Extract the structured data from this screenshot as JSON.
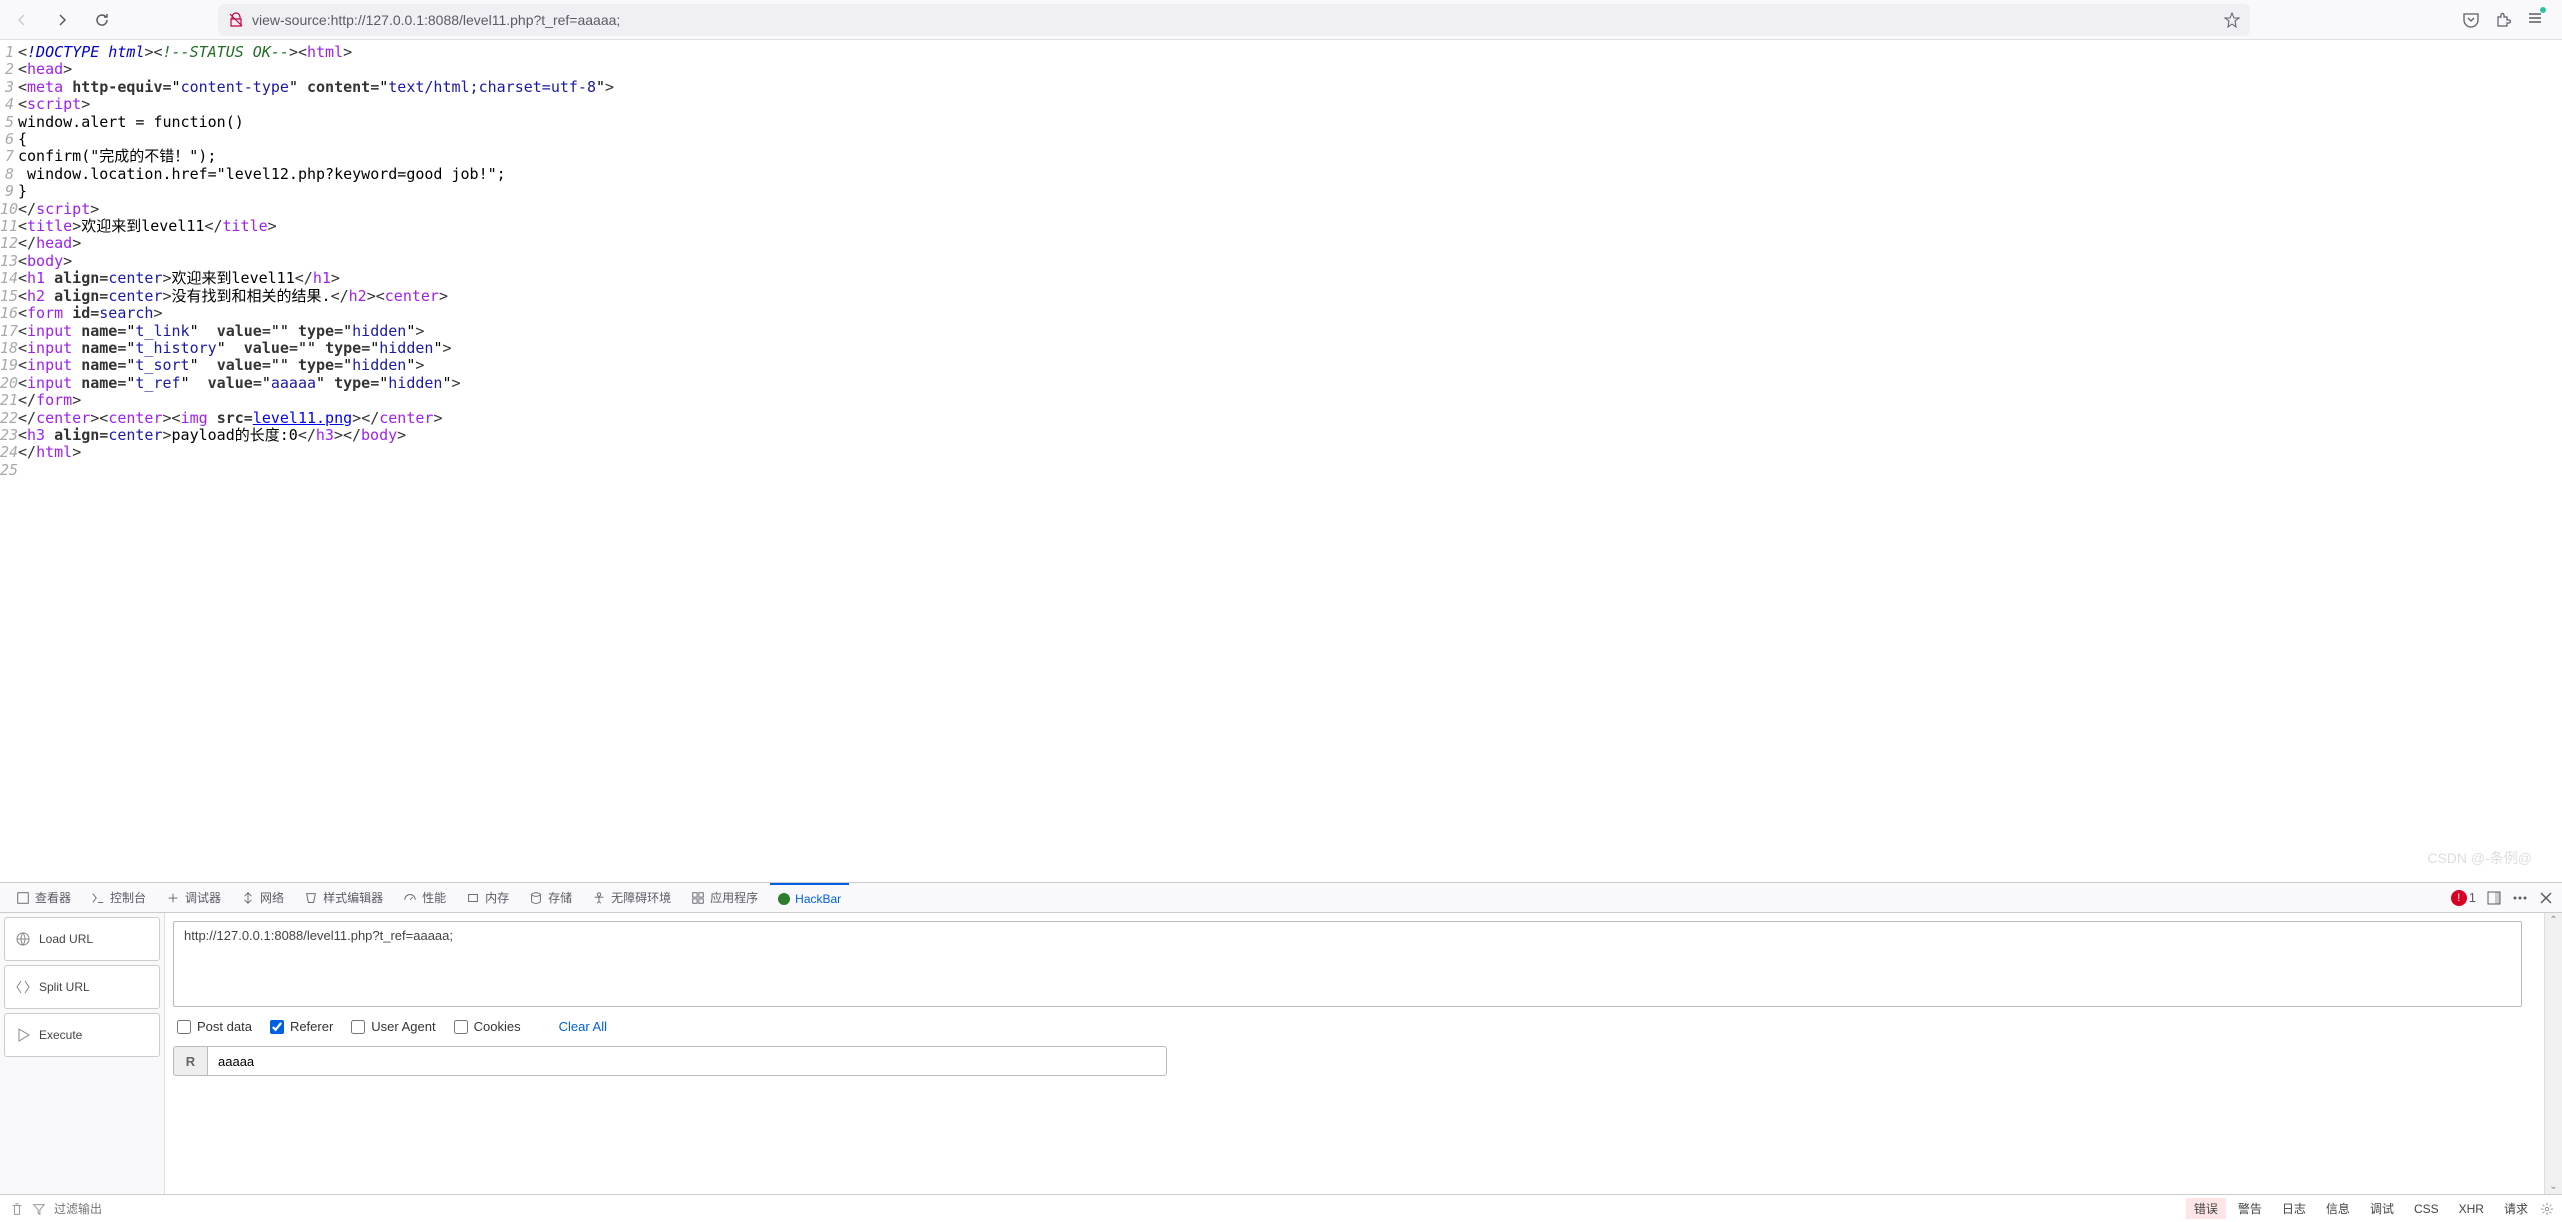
{
  "browser": {
    "url": "view-source:http://127.0.0.1:8088/level11.php?t_ref=aaaaa;"
  },
  "source_lines": [
    "1",
    "2",
    "3",
    "4",
    "5",
    "6",
    "7",
    "8",
    "9",
    "10",
    "11",
    "12",
    "13",
    "14",
    "15",
    "16",
    "17",
    "18",
    "19",
    "20",
    "21",
    "22",
    "23",
    "24",
    "25"
  ],
  "devtools": {
    "tabs": {
      "inspector": "查看器",
      "console": "控制台",
      "debugger": "调试器",
      "network": "网络",
      "styles": "样式编辑器",
      "perf": "性能",
      "memory": "内存",
      "storage": "存储",
      "a11y": "无障碍环境",
      "app": "应用程序",
      "hackbar": "HackBar"
    },
    "error_count": "1",
    "hackbar": {
      "load_url": "Load URL",
      "split_url": "Split URL",
      "execute": "Execute",
      "url_value": "http://127.0.0.1:8088/level11.php?t_ref=aaaaa;",
      "post_data": "Post data",
      "referer": "Referer",
      "user_agent": "User Agent",
      "cookies": "Cookies",
      "clear_all": "Clear All",
      "ref_label": "R",
      "ref_value": "aaaaa"
    },
    "bottom": {
      "filter_placeholder": "过滤输出",
      "buttons": {
        "error": "错误",
        "warn": "警告",
        "log": "日志",
        "info": "信息",
        "debug": "调试",
        "css": "CSS",
        "xhr": "XHR",
        "req": "请求"
      }
    }
  },
  "code": {
    "l1_doctype": "!DOCTYPE html",
    "l1_comment": "!--STATUS OK--",
    "l1_html": "html",
    "l2_head": "head",
    "l3_meta": "meta",
    "l3_he": "http-equiv",
    "l3_ct": "content-type",
    "l3_c": "content",
    "l3_cv": "text/html;charset=utf-8",
    "l4_script": "script",
    "l5": "window.alert = function()",
    "l6": "{",
    "l7": "confirm(\"完成的不错！\");",
    "l8": " window.location.href=\"level12.php?keyword=good job!\"; ",
    "l9": "}",
    "l10_script": "script",
    "l11_title": "title",
    "l11_text": "欢迎来到level11",
    "l12_head": "head",
    "l13_body": "body",
    "l14_h1": "h1",
    "l14_align": "align",
    "l14_center": "center",
    "l14_text": "欢迎来到level11",
    "l15_h2": "h2",
    "l15_text": "没有找到和相关的结果.",
    "l15_center": "center",
    "l16_form": "form",
    "l16_id": "id",
    "l16_search": "search",
    "l17_input": "input",
    "l17_name": "name",
    "l17_tlink": "t_link",
    "l17_value": "value",
    "l17_type": "type",
    "l17_hidden": "hidden",
    "l18_thistory": "t_history",
    "l19_tsort": "t_sort",
    "l20_tref": "t_ref",
    "l20_aaaaa": "aaaaa",
    "l21_form": "form",
    "l22_center": "center",
    "l22_img": "img",
    "l22_src": "src",
    "l22_png": "level11.png",
    "l23_h3": "h3",
    "l23_text": "payload的长度:0",
    "l23_body": "body",
    "l24_html": "html"
  },
  "watermark": "CSDN @-条例@"
}
